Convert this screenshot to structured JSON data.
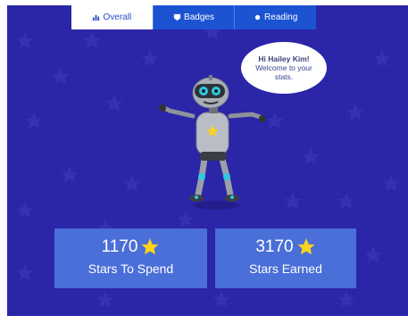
{
  "tabs": [
    {
      "label": "Overall",
      "icon": "bar-chart-icon",
      "active": true
    },
    {
      "label": "Badges",
      "icon": "badge-icon",
      "active": false
    },
    {
      "label": "Reading",
      "icon": "dot-icon",
      "active": false
    }
  ],
  "bubble": {
    "greeting": "Hi Hailey Kim!",
    "line1": "Welcome to your",
    "line2": "stats."
  },
  "stats": {
    "spend": {
      "value": "1170",
      "label": "Stars To Spend",
      "icon": "star-icon"
    },
    "earned": {
      "value": "3170",
      "label": "Stars Earned",
      "icon": "star-icon"
    }
  },
  "colors": {
    "background": "#2b25a8",
    "tab_blue": "#1c53d3",
    "card": "#4a6fd8",
    "star": "#ffd21e"
  }
}
